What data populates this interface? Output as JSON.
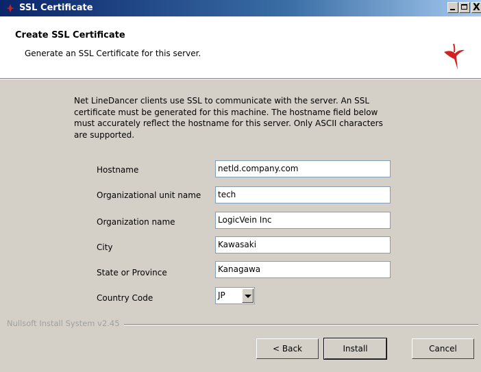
{
  "window": {
    "title": "SSL Certificate",
    "controls": [
      "minimize",
      "maximize",
      "close"
    ],
    "close_glyph": "X"
  },
  "header": {
    "title": "Create SSL Certificate",
    "subtitle": "Generate an SSL Certificate for this server.",
    "logo_icon": "linedancer-logo-icon"
  },
  "intro": {
    "lines": [
      "Net LineDancer clients use SSL to communicate with the server.  An SSL",
      "certificate must be generated for this machine.  The hostname field below",
      "must accurately reflect the hostname for this server.  Only ASCII characters",
      "are supported."
    ]
  },
  "form": {
    "hostname": {
      "label": "Hostname",
      "value": "netld.company.com"
    },
    "org_unit": {
      "label": "Organizational unit name",
      "value": "tech"
    },
    "org_name": {
      "label": "Organization name",
      "value": "LogicVein Inc"
    },
    "city": {
      "label": "City",
      "value": "Kawasaki"
    },
    "state": {
      "label": "State or Province",
      "value": "Kanagawa"
    },
    "country": {
      "label": "Country Code",
      "value": "JP"
    }
  },
  "branding": "Nullsoft Install System v2.45",
  "buttons": {
    "back": "< Back",
    "install": "Install",
    "cancel": "Cancel"
  }
}
